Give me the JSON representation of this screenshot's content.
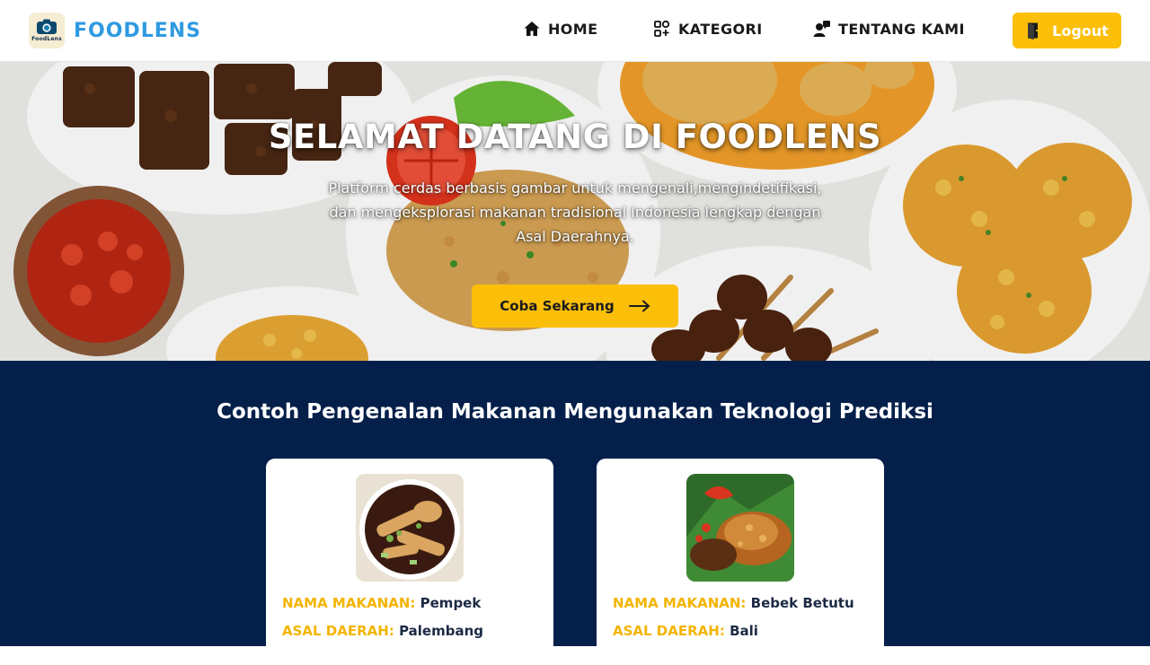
{
  "brand": {
    "name": "FOODLENS",
    "logo_text": "FoodLens",
    "brand_color": "#2f9ae0"
  },
  "nav": {
    "items": [
      {
        "label": "HOME",
        "icon": "home-icon"
      },
      {
        "label": "KATEGORI",
        "icon": "grid-icon"
      },
      {
        "label": "TENTANG KAMI",
        "icon": "team-icon"
      }
    ],
    "logout_label": "Logout",
    "logout_icon": "door-exit-icon"
  },
  "hero": {
    "title": "SELAMAT DATANG DI FOODLENS",
    "description": "Platform cerdas berbasis gambar untuk mengenali,mengindetifikasi, dan mengeksplorasi makanan tradisional Indonesia lengkap dengan Asal Daerahnya.",
    "cta_label": "Coba Sekarang",
    "cta_icon": "arrow-right-icon"
  },
  "section": {
    "title": "Contoh Pengenalan Makanan Mengunakan Teknologi Prediksi",
    "background": "#04204a",
    "cards": [
      {
        "name_key": "NAMA MAKANAN:",
        "name_value": "Pempek",
        "origin_key": "ASAL DAERAH:",
        "origin_value": "Palembang"
      },
      {
        "name_key": "NAMA MAKANAN:",
        "name_value": "Bebek Betutu",
        "origin_key": "ASAL DAERAH:",
        "origin_value": "Bali"
      }
    ]
  },
  "colors": {
    "accent": "#fbbf0a",
    "label_accent": "#f4b400",
    "navy": "#04204a"
  }
}
